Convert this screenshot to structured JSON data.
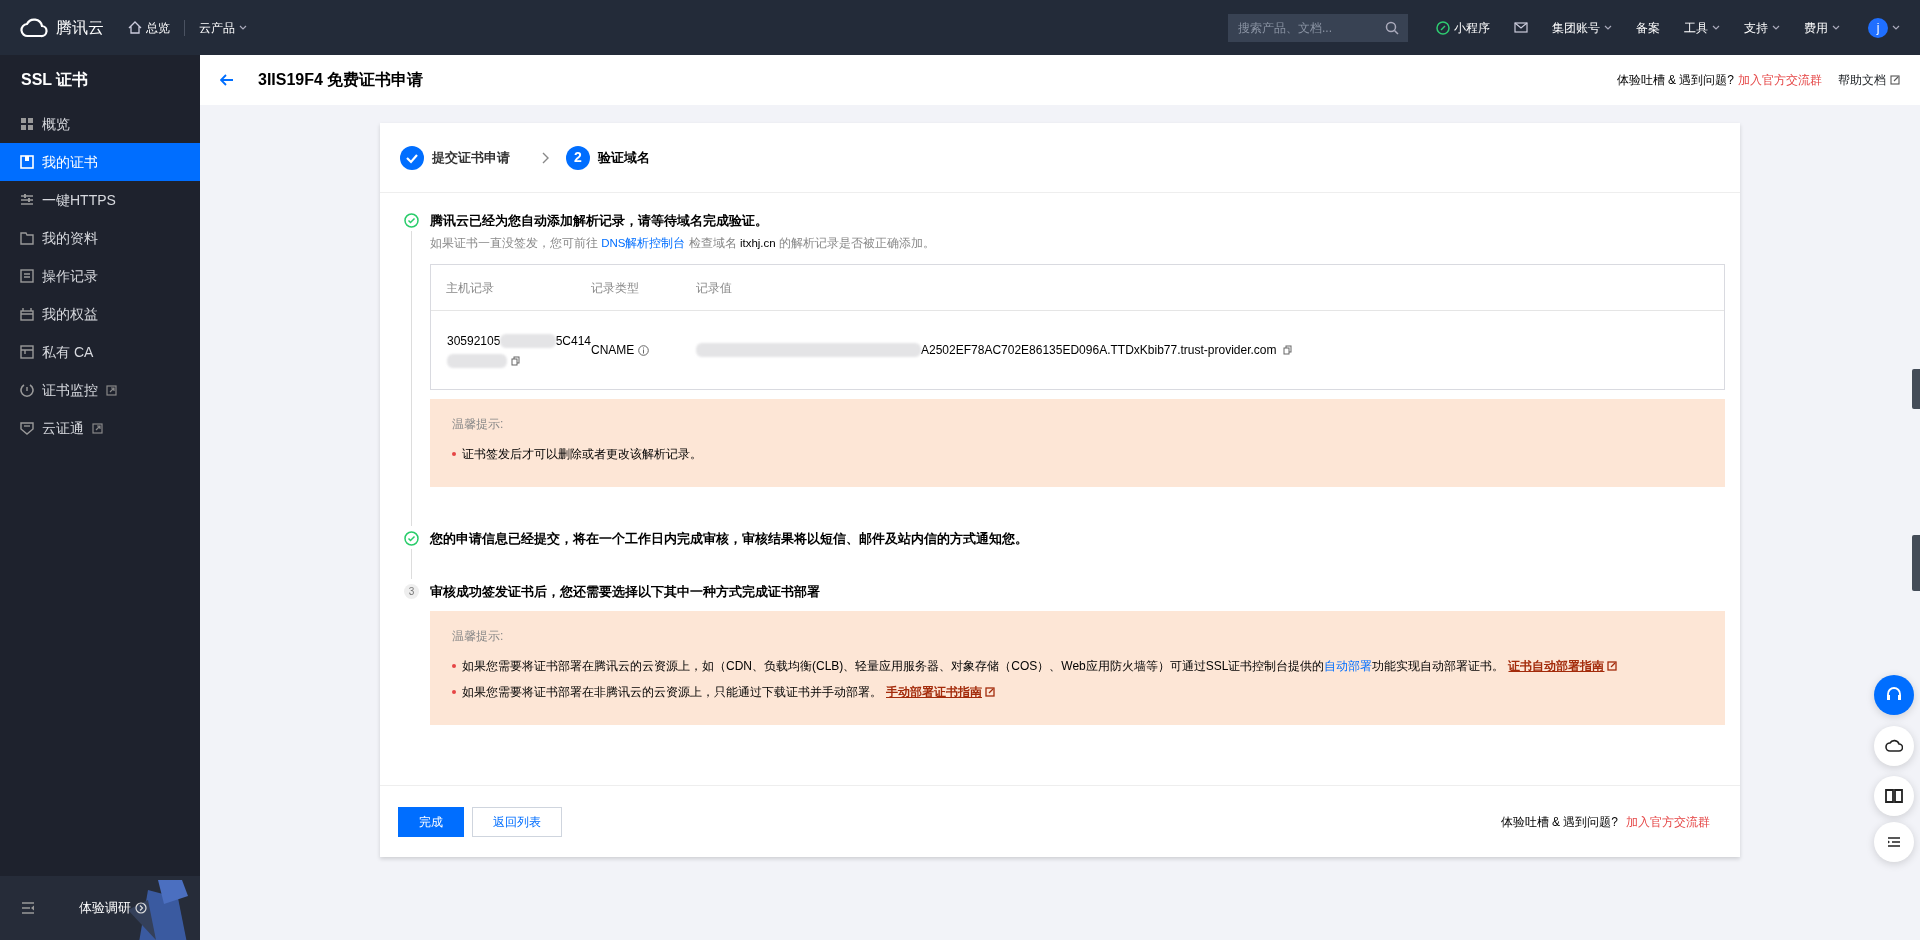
{
  "topbar": {
    "brand": "腾讯云",
    "nav": [
      {
        "kind": "home",
        "label": "总览"
      },
      {
        "kind": "dropdown",
        "label": "云产品"
      }
    ],
    "search": {
      "placeholder": "搜索产品、文档..."
    },
    "right_items": [
      {
        "kind": "miniapp",
        "label": "小程序",
        "caret": false
      },
      {
        "kind": "mail",
        "caret": false
      },
      {
        "kind": "text",
        "label": "集团账号",
        "caret": true
      },
      {
        "kind": "text",
        "label": "备案",
        "caret": false
      },
      {
        "kind": "text",
        "label": "工具",
        "caret": true
      },
      {
        "kind": "text",
        "label": "支持",
        "caret": true
      },
      {
        "kind": "text",
        "label": "费用",
        "caret": true
      }
    ],
    "avatar": "j"
  },
  "sidebar": {
    "title": "SSL 证书",
    "items": [
      {
        "label": "概览",
        "selected": false,
        "external": false
      },
      {
        "label": "我的证书",
        "selected": true,
        "external": false
      },
      {
        "label": "一键HTTPS",
        "selected": false,
        "external": false
      },
      {
        "label": "我的资料",
        "selected": false,
        "external": false
      },
      {
        "label": "操作记录",
        "selected": false,
        "external": false
      },
      {
        "label": "我的权益",
        "selected": false,
        "external": false
      },
      {
        "label": "私有 CA",
        "selected": false,
        "external": false
      },
      {
        "label": "证书监控",
        "selected": false,
        "external": true
      },
      {
        "label": "云证通",
        "selected": false,
        "external": true
      }
    ],
    "survey": "体验调研"
  },
  "header": {
    "title": "3IIS19F4 免费证书申请",
    "feedback": "体验吐槽 & 遇到问题?",
    "feedback_link": "加入官方交流群",
    "help": "帮助文档"
  },
  "steps": [
    {
      "label": "提交证书申请",
      "done": true,
      "selected": false
    },
    {
      "label": "验证域名",
      "number": "2",
      "done": false,
      "selected": true
    }
  ],
  "sections": [
    {
      "done": true,
      "title": "腾讯云已经为您自动添加解析记录，请等待域名完成验证。",
      "note": [
        {
          "kind": "text",
          "text": "如果证书一直没签发，您可前往 "
        },
        {
          "kind": "link",
          "text": "DNS解析控制台"
        },
        {
          "kind": "text",
          "text": " 检查域名 "
        },
        {
          "kind": "strong",
          "text": "itxhj.cn"
        },
        {
          "kind": "text",
          "text": " 的解析记录是否被正确添加。"
        }
      ],
      "table": {
        "columns": [
          "主机记录",
          "记录类型",
          "记录值"
        ],
        "rows": [
          {
            "host_start": "30592105",
            "host_end": "5C414",
            "type": "CNAME",
            "value": "A2502EF78AC702E86135ED096A.TTDxKbib77.trust-provider.com"
          }
        ]
      },
      "tip": {
        "title": "温馨提示:",
        "bullets": [
          [
            {
              "kind": "text",
              "text": "证书签发后才可以删除或者更改该解析记录。"
            }
          ]
        ]
      }
    },
    {
      "done": true,
      "title": "您的申请信息已经提交，将在一个工作日内完成审核，审核结果将以短信、邮件及站内信的方式通知您。"
    },
    {
      "done": false,
      "number": "3",
      "title": "审核成功签发证书后，您还需要选择以下其中一种方式完成证书部署",
      "tip": {
        "title": "温馨提示:",
        "bullets": [
          [
            {
              "kind": "text",
              "text": "如果您需要将证书部署在腾讯云的云资源上，如（CDN、负载均衡(CLB)、轻量应用服务器、对象存储（COS）、Web应用防火墙等）可通过SSL证书控制台提供的 "
            },
            {
              "kind": "link",
              "text": "自动部署"
            },
            {
              "kind": "text",
              "text": " 功能实现自动部署证书。"
            },
            {
              "kind": "guide",
              "text": "证书自动部署指南"
            }
          ],
          [
            {
              "kind": "text",
              "text": "如果您需要将证书部署在非腾讯云的云资源上，只能通过下载证书并手动部署。 "
            },
            {
              "kind": "guide",
              "text": "手动部署证书指南"
            }
          ]
        ]
      }
    }
  ],
  "footer": {
    "buttons": [
      {
        "kind": "primary",
        "label": "完成"
      },
      {
        "kind": "secondary",
        "label": "返回列表"
      }
    ],
    "feedback": "体验吐槽 & 遇到问题?",
    "feedback_link": "加入官方交流群"
  }
}
